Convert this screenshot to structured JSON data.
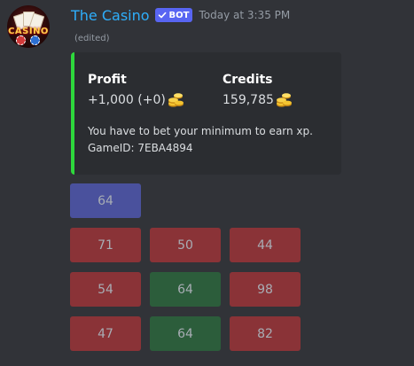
{
  "author": {
    "username": "The Casino",
    "bot_tag": "BOT",
    "timestamp": "Today at 3:35 PM",
    "edited_label": "(edited)",
    "avatar_text": "CASINO"
  },
  "embed": {
    "accent_color": "#2ed83c",
    "fields": [
      {
        "name": "Profit",
        "value": "+1,000 (+0)",
        "icon": "coins-icon"
      },
      {
        "name": "Credits",
        "value": "159,785",
        "icon": "coins-icon"
      }
    ],
    "description_line1": "You have to bet your minimum to earn xp.",
    "description_line2": "GameID: 7EBA4894"
  },
  "buttons": {
    "row1": [
      {
        "label": "64",
        "style": "primary",
        "color": "#4a519d"
      }
    ],
    "row2": [
      {
        "label": "71",
        "style": "danger",
        "color": "#8a3337"
      },
      {
        "label": "50",
        "style": "danger",
        "color": "#8a3337"
      },
      {
        "label": "44",
        "style": "danger",
        "color": "#8a3337"
      }
    ],
    "row3": [
      {
        "label": "54",
        "style": "danger",
        "color": "#8a3337"
      },
      {
        "label": "64",
        "style": "success",
        "color": "#2c5d3b"
      },
      {
        "label": "98",
        "style": "danger",
        "color": "#8a3337"
      }
    ],
    "row4": [
      {
        "label": "47",
        "style": "danger",
        "color": "#8a3337"
      },
      {
        "label": "64",
        "style": "success",
        "color": "#2c5d3b"
      },
      {
        "label": "82",
        "style": "danger",
        "color": "#8a3337"
      }
    ]
  },
  "colors": {
    "background": "#313338",
    "embed_background": "#2b2d31",
    "username": "#2eaefb",
    "bot_badge": "#5865f2"
  }
}
